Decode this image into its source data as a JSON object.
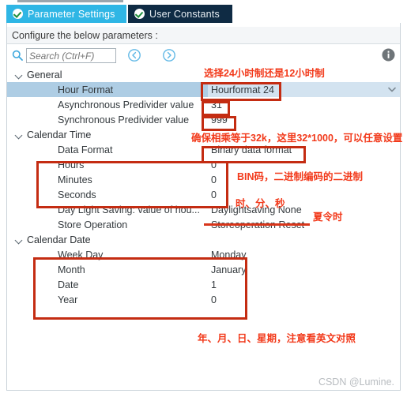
{
  "window": {
    "tabs": [
      {
        "label": "Parameter Settings",
        "icon": "check-circle-icon",
        "active": true
      },
      {
        "label": "User Constants",
        "icon": "check-circle-icon",
        "active": false
      }
    ],
    "configure_bar": "Configure the below parameters :",
    "watermark": "CSDN @Lumine."
  },
  "toolbar": {
    "search_placeholder": "Search (Ctrl+F)",
    "search_value": "",
    "search_icon": "search-icon",
    "prev_icon": "circle-chevron-left-icon",
    "next_icon": "circle-chevron-right-icon",
    "info_icon": "info-circle-icon"
  },
  "tree": {
    "groups": [
      {
        "label": "General",
        "chevron": "chevron-down-icon",
        "rows": [
          {
            "name": "Hour Format",
            "value": "Hourformat 24",
            "selected": true,
            "dropdown": true
          },
          {
            "name": "Asynchronous Predivider value",
            "value": "31",
            "selected": false,
            "dropdown": false
          },
          {
            "name": "Synchronous Predivider value",
            "value": "999",
            "selected": false,
            "dropdown": false
          }
        ]
      },
      {
        "label": "Calendar Time",
        "chevron": "chevron-down-icon",
        "rows": [
          {
            "name": "Data Format",
            "value": "Binary data format",
            "selected": false,
            "dropdown": false
          },
          {
            "name": "Hours",
            "value": "0",
            "selected": false,
            "dropdown": false
          },
          {
            "name": "Minutes",
            "value": "0",
            "selected": false,
            "dropdown": false
          },
          {
            "name": "Seconds",
            "value": "0",
            "selected": false,
            "dropdown": false
          },
          {
            "name": "Day Light Saving: value of hou...",
            "value": "Daylightsaving None",
            "selected": false,
            "dropdown": false
          },
          {
            "name": "Store Operation",
            "value": "Storeoperation Reset",
            "selected": false,
            "dropdown": false
          }
        ]
      },
      {
        "label": "Calendar Date",
        "chevron": "chevron-down-icon",
        "rows": [
          {
            "name": "Week Day",
            "value": "Monday",
            "selected": false,
            "dropdown": false
          },
          {
            "name": "Month",
            "value": "January",
            "selected": false,
            "dropdown": false
          },
          {
            "name": "Date",
            "value": "1",
            "selected": false,
            "dropdown": false
          },
          {
            "name": "Year",
            "value": "0",
            "selected": false,
            "dropdown": false
          }
        ]
      }
    ]
  },
  "annotations": {
    "color": "#f2391a",
    "box_color": "#c42c12",
    "notes": [
      {
        "id": "hour_format_note",
        "text": "选择24小时制还是12小时制"
      },
      {
        "id": "predivider_note",
        "text": "确保相乘等于32k，这里32*1000，可以任意设置"
      },
      {
        "id": "bin_note",
        "text": "BIN码，二进制编码的二进制"
      },
      {
        "id": "hms_note",
        "text": "时、分、秒"
      },
      {
        "id": "dst_note",
        "text": "夏令时"
      },
      {
        "id": "date_note",
        "text": "年、月、日、星期，注意看英文对照"
      }
    ]
  }
}
